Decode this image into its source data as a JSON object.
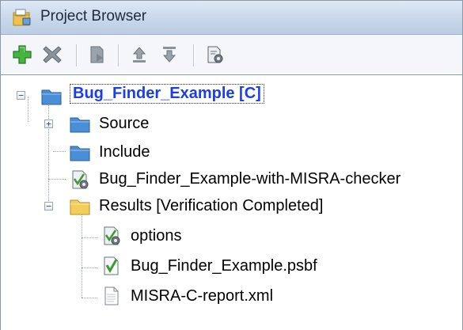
{
  "window": {
    "title": "Project Browser"
  },
  "toolbar": {
    "buttons": [
      {
        "icon": "plus-icon"
      },
      {
        "icon": "remove-icon"
      },
      {
        "icon": "run-icon"
      },
      {
        "icon": "move-up-icon"
      },
      {
        "icon": "move-down-icon"
      },
      {
        "icon": "configure-icon"
      }
    ]
  },
  "tree": {
    "root": {
      "label": "Bug_Finder_Example [C]",
      "expanded": true,
      "selected": true
    },
    "children": [
      {
        "label": "Source",
        "expandable": true,
        "expanded": false,
        "icon": "folder-blue-icon"
      },
      {
        "label": "Include",
        "expandable": false,
        "icon": "folder-blue-icon"
      },
      {
        "label": "Bug_Finder_Example-with-MISRA-checker",
        "expandable": false,
        "icon": "config-file-icon"
      },
      {
        "label": "Results [Verification Completed]",
        "expandable": true,
        "expanded": true,
        "icon": "folder-yellow-icon",
        "children": [
          {
            "label": "options",
            "icon": "config-file-icon"
          },
          {
            "label": "Bug_Finder_Example.psbf",
            "icon": "result-file-icon"
          },
          {
            "label": "MISRA-C-report.xml",
            "icon": "document-icon"
          }
        ]
      }
    ]
  },
  "colors": {
    "selection_text": "#1a3eea",
    "folder_blue": "#4a8fd6",
    "folder_yellow": "#f2cf5b",
    "green_plus": "#39a437"
  }
}
